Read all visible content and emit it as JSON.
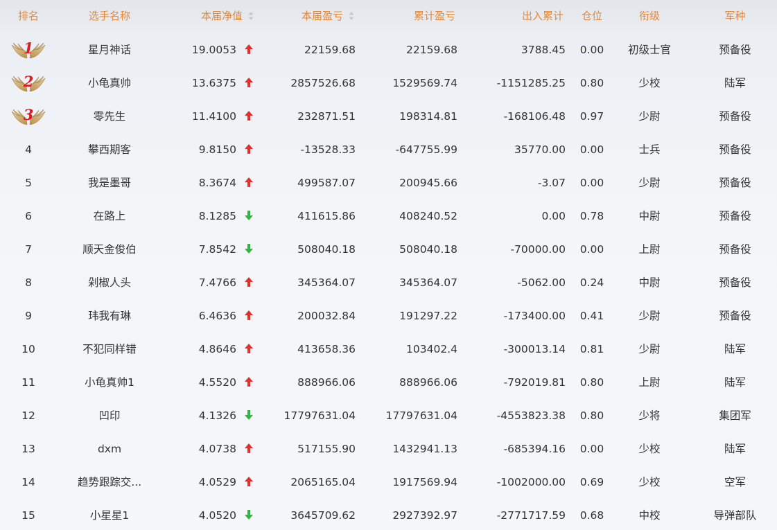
{
  "columns": {
    "rank": "排名",
    "name": "选手名称",
    "nav": "本届净值",
    "current_pl": "本届盈亏",
    "cumulative_pl": "累计盈亏",
    "flow": "出入累计",
    "position": "仓位",
    "title": "衔级",
    "branch": "军种"
  },
  "colors": {
    "header_text": "#e2893b",
    "arrow_up": "#e03131",
    "arrow_down": "#2fb344",
    "medal_number": "#d81e1e",
    "wing": "#c8a46a"
  },
  "rows": [
    {
      "rank": "1",
      "medal": true,
      "name": "星月神话",
      "nav": "19.0053",
      "trend": "up",
      "current_pl": "22159.68",
      "cumulative_pl": "22159.68",
      "flow": "3788.45",
      "position": "0.00",
      "title": "初级士官",
      "branch": "预备役"
    },
    {
      "rank": "2",
      "medal": true,
      "name": "小龟真帅",
      "nav": "13.6375",
      "trend": "up",
      "current_pl": "2857526.68",
      "cumulative_pl": "1529569.74",
      "flow": "-1151285.25",
      "position": "0.80",
      "title": "少校",
      "branch": "陆军"
    },
    {
      "rank": "3",
      "medal": true,
      "name": "零先生",
      "nav": "11.4100",
      "trend": "up",
      "current_pl": "232871.51",
      "cumulative_pl": "198314.81",
      "flow": "-168106.48",
      "position": "0.97",
      "title": "少尉",
      "branch": "预备役"
    },
    {
      "rank": "4",
      "medal": false,
      "name": "攀西期客",
      "nav": "9.8150",
      "trend": "up",
      "current_pl": "-13528.33",
      "cumulative_pl": "-647755.99",
      "flow": "35770.00",
      "position": "0.00",
      "title": "士兵",
      "branch": "预备役"
    },
    {
      "rank": "5",
      "medal": false,
      "name": "我是墨哥",
      "nav": "8.3674",
      "trend": "up",
      "current_pl": "499587.07",
      "cumulative_pl": "200945.66",
      "flow": "-3.07",
      "position": "0.00",
      "title": "少尉",
      "branch": "预备役"
    },
    {
      "rank": "6",
      "medal": false,
      "name": "在路上",
      "nav": "8.1285",
      "trend": "down",
      "current_pl": "411615.86",
      "cumulative_pl": "408240.52",
      "flow": "0.00",
      "position": "0.78",
      "title": "中尉",
      "branch": "预备役"
    },
    {
      "rank": "7",
      "medal": false,
      "name": "顺天金俊伯",
      "nav": "7.8542",
      "trend": "down",
      "current_pl": "508040.18",
      "cumulative_pl": "508040.18",
      "flow": "-70000.00",
      "position": "0.00",
      "title": "上尉",
      "branch": "预备役"
    },
    {
      "rank": "8",
      "medal": false,
      "name": "剁椒人头",
      "nav": "7.4766",
      "trend": "up",
      "current_pl": "345364.07",
      "cumulative_pl": "345364.07",
      "flow": "-5062.00",
      "position": "0.24",
      "title": "中尉",
      "branch": "预备役"
    },
    {
      "rank": "9",
      "medal": false,
      "name": "玮我有琳",
      "nav": "6.4636",
      "trend": "up",
      "current_pl": "200032.84",
      "cumulative_pl": "191297.22",
      "flow": "-173400.00",
      "position": "0.41",
      "title": "少尉",
      "branch": "预备役"
    },
    {
      "rank": "10",
      "medal": false,
      "name": "不犯同样错",
      "nav": "4.8646",
      "trend": "up",
      "current_pl": "413658.36",
      "cumulative_pl": "103402.4",
      "flow": "-300013.14",
      "position": "0.81",
      "title": "少尉",
      "branch": "陆军"
    },
    {
      "rank": "11",
      "medal": false,
      "name": "小龟真帅1",
      "nav": "4.5520",
      "trend": "up",
      "current_pl": "888966.06",
      "cumulative_pl": "888966.06",
      "flow": "-792019.81",
      "position": "0.80",
      "title": "上尉",
      "branch": "陆军"
    },
    {
      "rank": "12",
      "medal": false,
      "name": "凹印",
      "nav": "4.1326",
      "trend": "down",
      "current_pl": "17797631.04",
      "cumulative_pl": "17797631.04",
      "flow": "-4553823.38",
      "position": "0.80",
      "title": "少将",
      "branch": "集团军"
    },
    {
      "rank": "13",
      "medal": false,
      "name": "dxm",
      "nav": "4.0738",
      "trend": "up",
      "current_pl": "517155.90",
      "cumulative_pl": "1432941.13",
      "flow": "-685394.16",
      "position": "0.00",
      "title": "少校",
      "branch": "陆军"
    },
    {
      "rank": "14",
      "medal": false,
      "name": "趋势跟踪交...",
      "nav": "4.0529",
      "trend": "up",
      "current_pl": "2065165.04",
      "cumulative_pl": "1917569.94",
      "flow": "-1002000.00",
      "position": "0.69",
      "title": "少校",
      "branch": "空军"
    },
    {
      "rank": "15",
      "medal": false,
      "name": "小星星1",
      "nav": "4.0520",
      "trend": "down",
      "current_pl": "3645709.62",
      "cumulative_pl": "2927392.97",
      "flow": "-2771717.59",
      "position": "0.68",
      "title": "中校",
      "branch": "导弹部队"
    }
  ]
}
